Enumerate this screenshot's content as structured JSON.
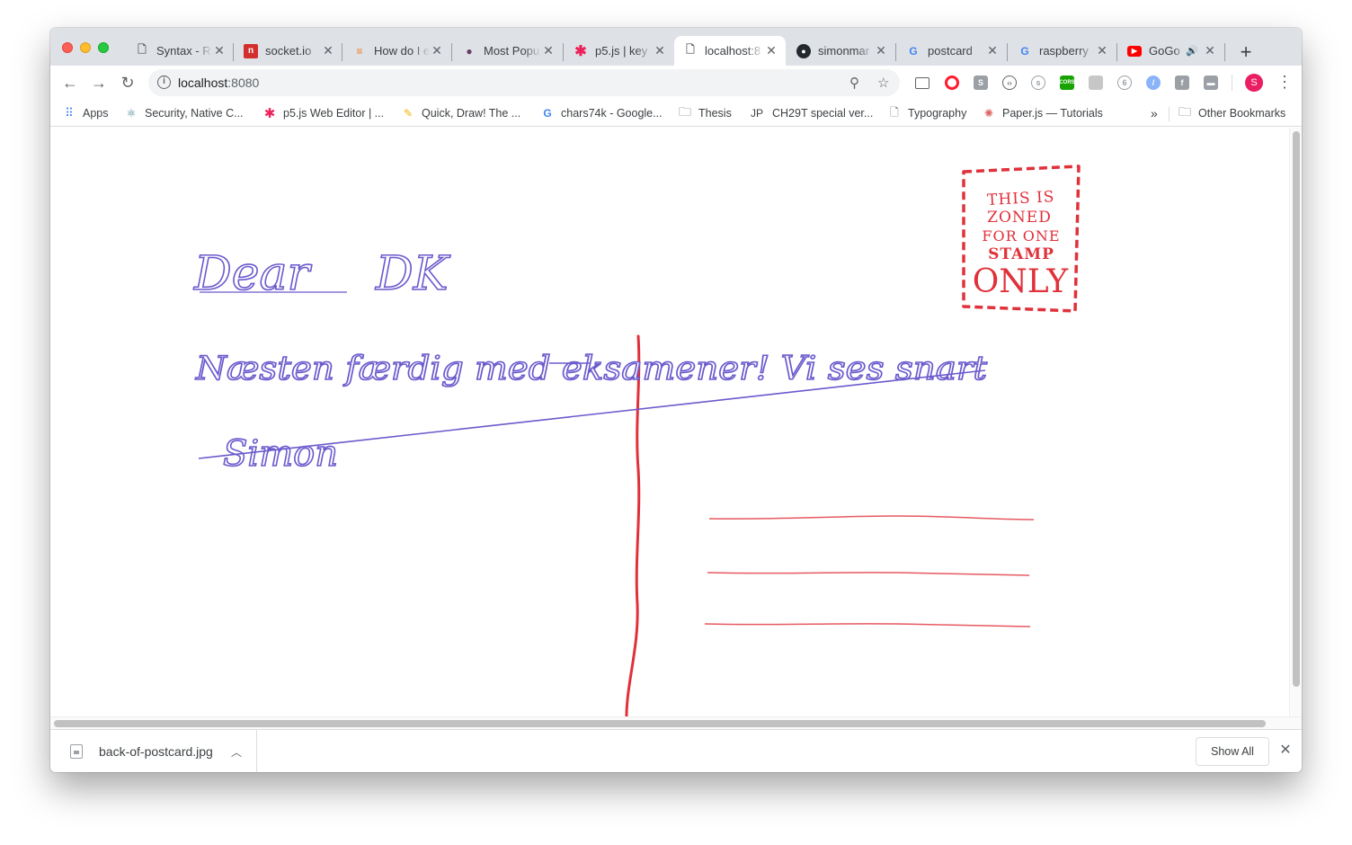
{
  "tabs": [
    {
      "title": "Syntax - R",
      "icon": "document-icon"
    },
    {
      "title": "socket.io",
      "icon": "socketio-icon"
    },
    {
      "title": "How do I e",
      "icon": "stackoverflow-icon"
    },
    {
      "title": "Most Popu",
      "icon": "mushroom-icon"
    },
    {
      "title": "p5.js | key",
      "icon": "asterisk-icon"
    },
    {
      "title": "localhost:8",
      "icon": "document-icon",
      "active": true
    },
    {
      "title": "simonmar",
      "icon": "github-icon"
    },
    {
      "title": "postcard",
      "icon": "google-icon"
    },
    {
      "title": "raspberry",
      "icon": "google-icon"
    },
    {
      "title": "GoGo",
      "icon": "youtube-icon",
      "audio": true
    }
  ],
  "toolbar": {
    "url_host": "localhost",
    "url_port": ":8080"
  },
  "bookmarks": [
    {
      "label": "Apps",
      "icon": "apps-grid-icon"
    },
    {
      "label": "Security, Native C...",
      "icon": "atom-icon"
    },
    {
      "label": "p5.js Web Editor | ...",
      "icon": "asterisk-icon"
    },
    {
      "label": "Quick, Draw! The ...",
      "icon": "pencil-icon"
    },
    {
      "label": "chars74k - Google...",
      "icon": "google-icon"
    },
    {
      "label": "Thesis",
      "icon": "folder-icon"
    },
    {
      "label": "CH29T special ver...",
      "icon": "jp-icon"
    },
    {
      "label": "Typography",
      "icon": "document-icon"
    },
    {
      "label": "Paper.js — Tutorials",
      "icon": "paperjs-icon"
    }
  ],
  "bookmarks_overflow": "»",
  "other_bookmarks": "Other Bookmarks",
  "postcard": {
    "line1_a": "Dear",
    "line1_b": "DK",
    "line2": "Næsten færdig med eksamener! Vi ses snart",
    "line3": "Simon",
    "stamp_lines": [
      "THIS IS",
      "ZONED",
      "FOR ONE",
      "STAMP",
      "ONLY"
    ],
    "ink_color": "#6a5acd",
    "red_color": "#e0313a"
  },
  "downloads": {
    "filename": "back-of-postcard.jpg",
    "show_all": "Show All"
  },
  "profile_initial": "S"
}
